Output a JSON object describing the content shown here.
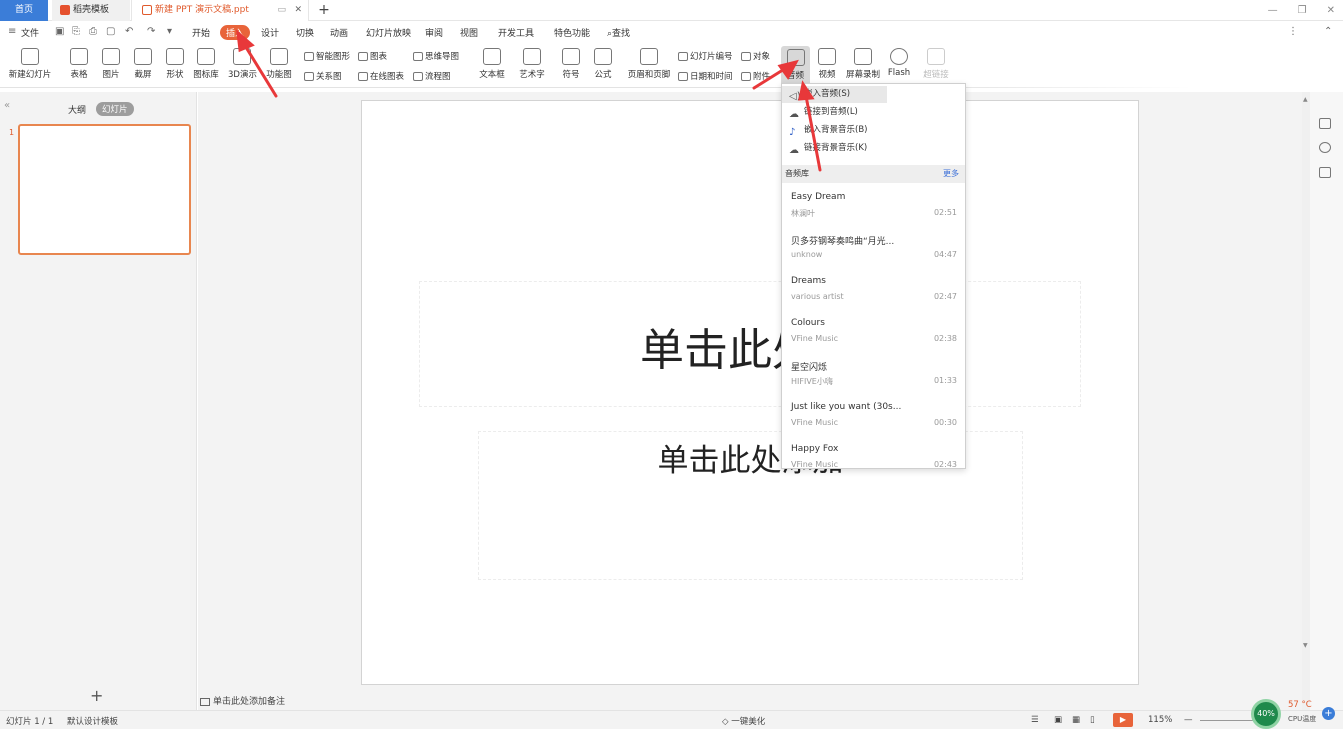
{
  "tabs": {
    "home": "首页",
    "template": "稻壳模板",
    "document": "新建 PPT 演示文稿.ppt"
  },
  "menu": {
    "file": "文件",
    "items": [
      "开始",
      "插入",
      "设计",
      "切换",
      "动画",
      "幻灯片放映",
      "审阅",
      "视图",
      "开发工具",
      "特色功能"
    ],
    "search": "查找"
  },
  "ribbon": {
    "new_slide": "新建幻灯片",
    "table": "表格",
    "picture": "图片",
    "screenshot": "截屏",
    "shape": "形状",
    "icons": "图标库",
    "demo3d": "3D演示",
    "function_chart": "功能图",
    "smart_graphic": "智能图形",
    "chart": "图表",
    "relation": "关系图",
    "online_chart": "在线图表",
    "mind_map": "思维导图",
    "flow_chart": "流程图",
    "textbox": "文本框",
    "wordart": "艺术字",
    "symbol": "符号",
    "formula": "公式",
    "header_footer": "页眉和页脚",
    "slide_number": "幻灯片编号",
    "object": "对象",
    "datetime": "日期和时间",
    "attachment": "附件",
    "audio": "音频",
    "video": "视频",
    "screen_record": "屏幕录制",
    "flash": "Flash",
    "hyperlink": "超链接"
  },
  "left_panel": {
    "outline_tab": "大纲",
    "slides_tab": "幻灯片",
    "slide_number": "1"
  },
  "slide": {
    "title_placeholder": "单击此处添",
    "subtitle_placeholder": "单击此处添加",
    "notes_placeholder": "单击此处添加备注"
  },
  "audio_menu": {
    "insert_audio": "嵌入音频(S)",
    "link_audio": "链接到音频(L)",
    "insert_bgm": "嵌入背景音乐(B)",
    "link_bgm": "链接背景音乐(K)",
    "library_header": "音频库",
    "more": "更多",
    "songs": [
      {
        "title": "Easy Dream",
        "artist": "林澜叶",
        "duration": "02:51"
      },
      {
        "title": "贝多芬钢琴奏鸣曲“月光...",
        "artist": "unknow",
        "duration": "04:47"
      },
      {
        "title": "Dreams",
        "artist": "various artist",
        "duration": "02:47"
      },
      {
        "title": "Colours",
        "artist": "VFine Music",
        "duration": "02:38"
      },
      {
        "title": "星空闪烁",
        "artist": "HIFIVE小嗨",
        "duration": "01:33"
      },
      {
        "title": "Just like you want (30s...",
        "artist": "VFine Music",
        "duration": "00:30"
      },
      {
        "title": "Happy Fox",
        "artist": "VFine Music",
        "duration": "02:43"
      }
    ]
  },
  "status": {
    "slide_info": "幻灯片 1 / 1",
    "template": "默认设计模板",
    "beautify": "一键美化",
    "zoom": "115%",
    "cpu_percent": "40%",
    "cpu_temp": "57 °C",
    "cpu_label": "CPU温度"
  },
  "colors": {
    "accent": "#e8643a",
    "home_tab": "#3b7dd8",
    "arrow": "#e8383a"
  }
}
